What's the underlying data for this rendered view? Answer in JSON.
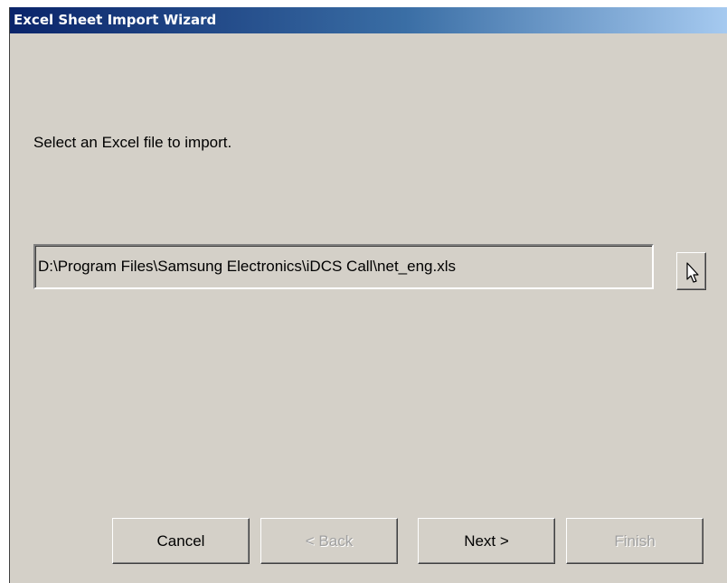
{
  "window": {
    "title": "Excel Sheet Import Wizard"
  },
  "main": {
    "prompt": "Select an Excel file to import.",
    "file_path": "D:\\Program Files\\Samsung Electronics\\iDCS Call\\net_eng.xls"
  },
  "icons": {
    "browse": "cursor-arrow-icon"
  },
  "buttons": {
    "cancel": "Cancel",
    "back": "< Back",
    "next": "Next >",
    "finish": "Finish"
  },
  "colors": {
    "title_gradient_start": "#0a246a",
    "title_gradient_end": "#a6caf0",
    "dialog_background": "#d4d0c8",
    "disabled_text": "#a0a0a0"
  }
}
